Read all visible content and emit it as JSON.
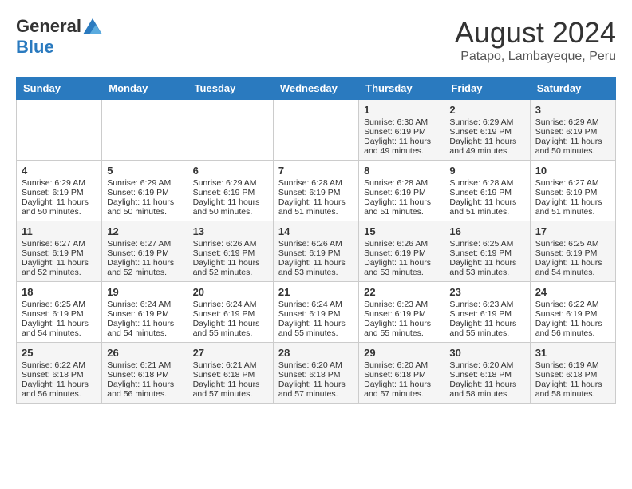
{
  "header": {
    "logo": {
      "general": "General",
      "blue": "Blue"
    },
    "title": "August 2024",
    "location": "Patapo, Lambayeque, Peru"
  },
  "calendar": {
    "days_of_week": [
      "Sunday",
      "Monday",
      "Tuesday",
      "Wednesday",
      "Thursday",
      "Friday",
      "Saturday"
    ],
    "weeks": [
      [
        {
          "day": "",
          "info": ""
        },
        {
          "day": "",
          "info": ""
        },
        {
          "day": "",
          "info": ""
        },
        {
          "day": "",
          "info": ""
        },
        {
          "day": "1",
          "info": "Sunrise: 6:30 AM\nSunset: 6:19 PM\nDaylight: 11 hours and 49 minutes."
        },
        {
          "day": "2",
          "info": "Sunrise: 6:29 AM\nSunset: 6:19 PM\nDaylight: 11 hours and 49 minutes."
        },
        {
          "day": "3",
          "info": "Sunrise: 6:29 AM\nSunset: 6:19 PM\nDaylight: 11 hours and 50 minutes."
        }
      ],
      [
        {
          "day": "4",
          "info": "Sunrise: 6:29 AM\nSunset: 6:19 PM\nDaylight: 11 hours and 50 minutes."
        },
        {
          "day": "5",
          "info": "Sunrise: 6:29 AM\nSunset: 6:19 PM\nDaylight: 11 hours and 50 minutes."
        },
        {
          "day": "6",
          "info": "Sunrise: 6:29 AM\nSunset: 6:19 PM\nDaylight: 11 hours and 50 minutes."
        },
        {
          "day": "7",
          "info": "Sunrise: 6:28 AM\nSunset: 6:19 PM\nDaylight: 11 hours and 51 minutes."
        },
        {
          "day": "8",
          "info": "Sunrise: 6:28 AM\nSunset: 6:19 PM\nDaylight: 11 hours and 51 minutes."
        },
        {
          "day": "9",
          "info": "Sunrise: 6:28 AM\nSunset: 6:19 PM\nDaylight: 11 hours and 51 minutes."
        },
        {
          "day": "10",
          "info": "Sunrise: 6:27 AM\nSunset: 6:19 PM\nDaylight: 11 hours and 51 minutes."
        }
      ],
      [
        {
          "day": "11",
          "info": "Sunrise: 6:27 AM\nSunset: 6:19 PM\nDaylight: 11 hours and 52 minutes."
        },
        {
          "day": "12",
          "info": "Sunrise: 6:27 AM\nSunset: 6:19 PM\nDaylight: 11 hours and 52 minutes."
        },
        {
          "day": "13",
          "info": "Sunrise: 6:26 AM\nSunset: 6:19 PM\nDaylight: 11 hours and 52 minutes."
        },
        {
          "day": "14",
          "info": "Sunrise: 6:26 AM\nSunset: 6:19 PM\nDaylight: 11 hours and 53 minutes."
        },
        {
          "day": "15",
          "info": "Sunrise: 6:26 AM\nSunset: 6:19 PM\nDaylight: 11 hours and 53 minutes."
        },
        {
          "day": "16",
          "info": "Sunrise: 6:25 AM\nSunset: 6:19 PM\nDaylight: 11 hours and 53 minutes."
        },
        {
          "day": "17",
          "info": "Sunrise: 6:25 AM\nSunset: 6:19 PM\nDaylight: 11 hours and 54 minutes."
        }
      ],
      [
        {
          "day": "18",
          "info": "Sunrise: 6:25 AM\nSunset: 6:19 PM\nDaylight: 11 hours and 54 minutes."
        },
        {
          "day": "19",
          "info": "Sunrise: 6:24 AM\nSunset: 6:19 PM\nDaylight: 11 hours and 54 minutes."
        },
        {
          "day": "20",
          "info": "Sunrise: 6:24 AM\nSunset: 6:19 PM\nDaylight: 11 hours and 55 minutes."
        },
        {
          "day": "21",
          "info": "Sunrise: 6:24 AM\nSunset: 6:19 PM\nDaylight: 11 hours and 55 minutes."
        },
        {
          "day": "22",
          "info": "Sunrise: 6:23 AM\nSunset: 6:19 PM\nDaylight: 11 hours and 55 minutes."
        },
        {
          "day": "23",
          "info": "Sunrise: 6:23 AM\nSunset: 6:19 PM\nDaylight: 11 hours and 55 minutes."
        },
        {
          "day": "24",
          "info": "Sunrise: 6:22 AM\nSunset: 6:19 PM\nDaylight: 11 hours and 56 minutes."
        }
      ],
      [
        {
          "day": "25",
          "info": "Sunrise: 6:22 AM\nSunset: 6:18 PM\nDaylight: 11 hours and 56 minutes."
        },
        {
          "day": "26",
          "info": "Sunrise: 6:21 AM\nSunset: 6:18 PM\nDaylight: 11 hours and 56 minutes."
        },
        {
          "day": "27",
          "info": "Sunrise: 6:21 AM\nSunset: 6:18 PM\nDaylight: 11 hours and 57 minutes."
        },
        {
          "day": "28",
          "info": "Sunrise: 6:20 AM\nSunset: 6:18 PM\nDaylight: 11 hours and 57 minutes."
        },
        {
          "day": "29",
          "info": "Sunrise: 6:20 AM\nSunset: 6:18 PM\nDaylight: 11 hours and 57 minutes."
        },
        {
          "day": "30",
          "info": "Sunrise: 6:20 AM\nSunset: 6:18 PM\nDaylight: 11 hours and 58 minutes."
        },
        {
          "day": "31",
          "info": "Sunrise: 6:19 AM\nSunset: 6:18 PM\nDaylight: 11 hours and 58 minutes."
        }
      ]
    ]
  }
}
